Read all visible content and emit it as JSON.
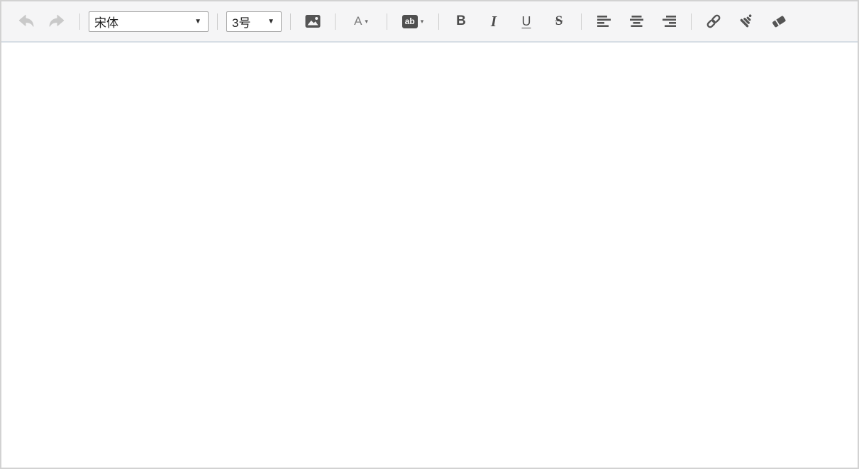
{
  "toolbar": {
    "undo": {
      "icon": "undo-arrow"
    },
    "redo": {
      "icon": "redo-arrow"
    },
    "font_family": {
      "value": "宋体"
    },
    "font_size": {
      "value": "3号"
    },
    "insert_image": {
      "icon": "image"
    },
    "font_color": {
      "label": "A"
    },
    "highlight_color": {
      "label": "ab"
    },
    "bold": {
      "label": "B"
    },
    "italic": {
      "label": "I"
    },
    "underline": {
      "label": "U"
    },
    "strikethrough": {
      "label": "S"
    },
    "align_left": {
      "icon": "align-left"
    },
    "align_center": {
      "icon": "align-center"
    },
    "align_right": {
      "icon": "align-right"
    },
    "link": {
      "icon": "link"
    },
    "format_brush": {
      "icon": "brush"
    },
    "eraser": {
      "icon": "eraser"
    }
  },
  "icons": {
    "dropdown_arrow": "▼",
    "caret_down": "▾"
  },
  "colors": {
    "toolbar_bg": "#f5f5f6",
    "toolbar_border_bottom": "#d7dee5",
    "outer_border": "#d2d2d2",
    "icon": "#555555",
    "icon_disabled": "#c9c9c9",
    "separator": "#cecece",
    "highlight_chip_bg": "#4f4f4f",
    "content_bg": "#ffffff"
  },
  "editor": {
    "content": ""
  }
}
